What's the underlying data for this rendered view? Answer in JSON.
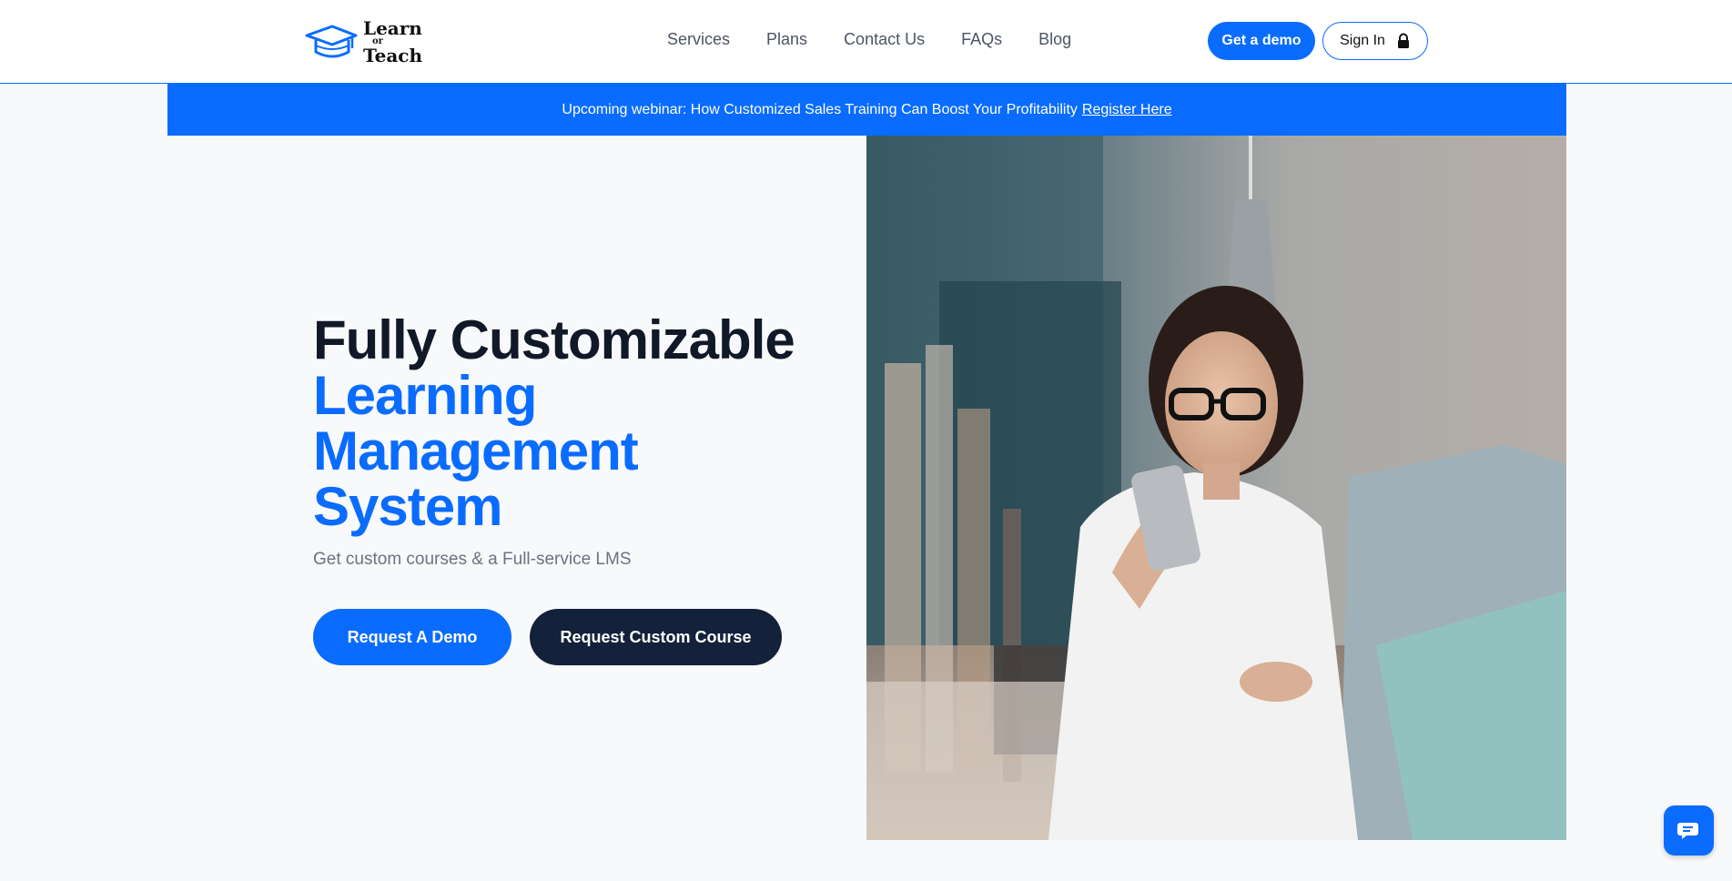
{
  "brand": {
    "line1": "Learn",
    "line2": "or",
    "line3": "Teach",
    "accent": "#0a6cff"
  },
  "nav": {
    "items": [
      {
        "label": "Services"
      },
      {
        "label": "Plans"
      },
      {
        "label": "Contact Us"
      },
      {
        "label": "FAQs"
      },
      {
        "label": "Blog"
      }
    ]
  },
  "header": {
    "demo_label": "Get a demo",
    "signin_label": "Sign In"
  },
  "banner": {
    "text": "Upcoming webinar: How Customized Sales Training Can Boost Your Profitability",
    "link": "Register Here"
  },
  "hero": {
    "title_dark": "Fully Customizable",
    "title_blue_1": "Learning",
    "title_blue_2": "Management",
    "title_blue_3": "System",
    "subtitle": "Get custom courses & a Full-service LMS",
    "primary_cta": "Request A Demo",
    "secondary_cta": "Request Custom Course",
    "image_alt": "woman-with-phone-and-laptop-photo"
  },
  "chat": {
    "icon": "chat-icon"
  }
}
